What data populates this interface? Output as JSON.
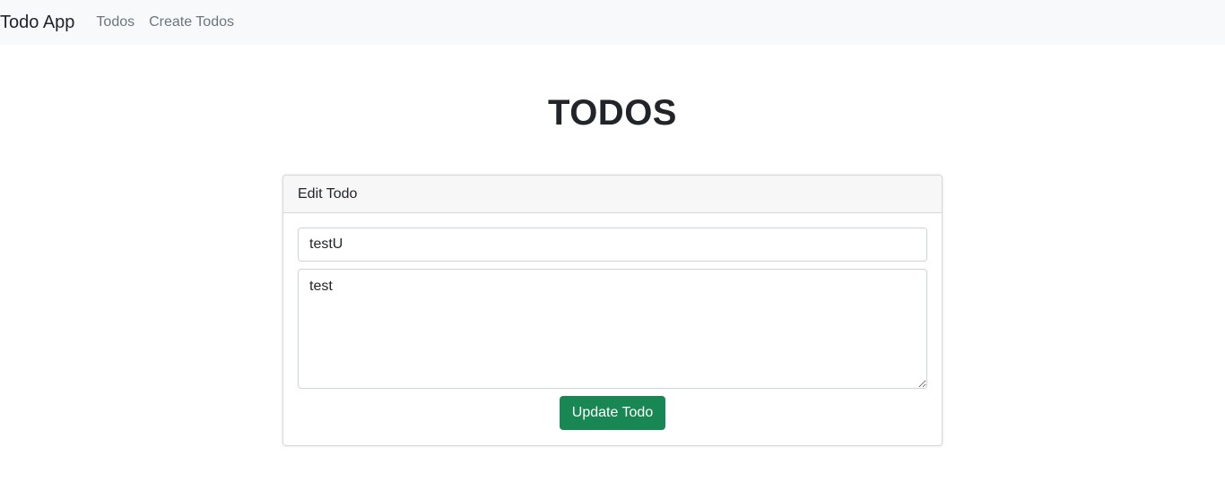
{
  "navbar": {
    "brand": "Todo App",
    "links": [
      {
        "label": "Todos"
      },
      {
        "label": "Create Todos"
      }
    ]
  },
  "page": {
    "title": "TODOS"
  },
  "edit_card": {
    "header": "Edit Todo",
    "title_value": "testU",
    "description_value": "test",
    "submit_label": "Update Todo"
  },
  "colors": {
    "navbar_bg": "#f8f9fa",
    "button_bg": "#198754",
    "button_text": "#ffffff"
  }
}
